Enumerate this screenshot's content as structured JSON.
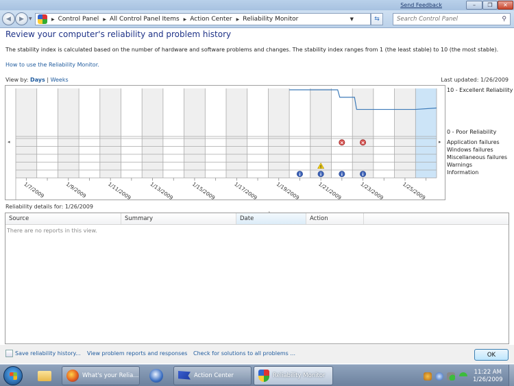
{
  "window": {
    "send_feedback": "Send Feedback",
    "minimize": "–",
    "maximize": "❐",
    "close": "✕"
  },
  "nav": {
    "back": "◀",
    "forward": "▶",
    "breadcrumbs": [
      "Control Panel",
      "All Control Panel Items",
      "Action Center",
      "Reliability Monitor"
    ],
    "search_placeholder": "Search Control Panel",
    "search_value": ""
  },
  "content": {
    "title": "Review your computer's reliability and problem history",
    "description": "The stability index is calculated based on the number of hardware and software problems and changes. The stability index ranges from 1 (the least stable) to 10 (the most stable).",
    "howto_link": "How to use the Reliability Monitor.",
    "view_by_label": "View by:",
    "view_by_days": "Days",
    "view_by_sep": " | ",
    "view_by_weeks": "Weeks",
    "last_updated": "Last updated: 1/26/2009"
  },
  "chart_data": {
    "type": "line",
    "title": "Reliability Monitor stability index",
    "x": [
      "1/7/2009",
      "1/8/2009",
      "1/9/2009",
      "1/10/2009",
      "1/11/2009",
      "1/12/2009",
      "1/13/2009",
      "1/14/2009",
      "1/15/2009",
      "1/16/2009",
      "1/17/2009",
      "1/18/2009",
      "1/19/2009",
      "1/20/2009",
      "1/21/2009",
      "1/22/2009",
      "1/23/2009",
      "1/24/2009",
      "1/25/2009",
      "1/26/2009"
    ],
    "tick_labels": [
      "1/7/2009",
      "1/9/2009",
      "1/11/2009",
      "1/13/2009",
      "1/15/2009",
      "1/17/2009",
      "1/19/2009",
      "1/21/2009",
      "1/23/2009",
      "1/25/2009"
    ],
    "ylim": [
      0,
      10
    ],
    "y_top_label": "10 - Excellent Reliability",
    "y_bottom_label": "0 - Poor Reliability",
    "stability_series": {
      "name": "Stability index",
      "points": [
        {
          "day": 13,
          "value": 10.0
        },
        {
          "day": 15.3,
          "value": 10.0
        },
        {
          "day": 15.4,
          "value": 8.4
        },
        {
          "day": 16.1,
          "value": 8.4
        },
        {
          "day": 16.2,
          "value": 5.8
        },
        {
          "day": 19.0,
          "value": 5.8
        },
        {
          "day": 20.0,
          "value": 6.1
        }
      ]
    },
    "event_rows": [
      "Application failures",
      "Windows failures",
      "Miscellaneous failures",
      "Warnings",
      "Information"
    ],
    "events": [
      {
        "row": "Application failures",
        "date": "1/22/2009",
        "type": "error"
      },
      {
        "row": "Application failures",
        "date": "1/23/2009",
        "type": "error"
      },
      {
        "row": "Warnings",
        "date": "1/21/2009",
        "type": "warning"
      },
      {
        "row": "Information",
        "date": "1/20/2009",
        "type": "info"
      },
      {
        "row": "Information",
        "date": "1/21/2009",
        "type": "info"
      },
      {
        "row": "Information",
        "date": "1/22/2009",
        "type": "info"
      },
      {
        "row": "Information",
        "date": "1/23/2009",
        "type": "info"
      }
    ],
    "selected_date": "1/26/2009",
    "colors": {
      "line": "#3d7ab8",
      "selected": "#cce4f7",
      "shaded": "#efefef",
      "grid": "#a9a9a9"
    }
  },
  "details": {
    "title": "Reliability details for: 1/26/2009",
    "columns": [
      "Source",
      "Summary",
      "Date",
      "Action"
    ],
    "sorted_column": "Date",
    "empty_message": "There are no reports in this view."
  },
  "footer": {
    "save_history": "Save reliability history...",
    "view_reports": "View problem reports and responses",
    "check_solutions": "Check for solutions to all problems ...",
    "ok": "OK"
  },
  "taskbar": {
    "buttons": [
      {
        "label": "What's your Relia...",
        "icon": "firefox-icon"
      },
      {
        "label": "Action Center",
        "icon": "action-center-flag-icon"
      },
      {
        "label": "Reliability Monitor",
        "icon": "reliability-shield-icon",
        "active": true
      }
    ],
    "clock_time": "11:22 AM",
    "clock_date": "1/26/2009"
  }
}
